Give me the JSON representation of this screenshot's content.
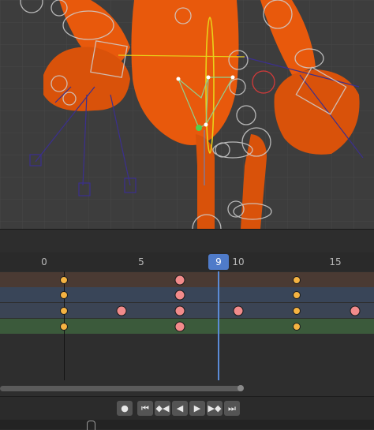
{
  "viewport": {
    "label": "3D viewport - orange character rig with bone controls",
    "colors": {
      "background": "#3d3d3d",
      "grid": "#4a4a4a",
      "character": "#e8590c",
      "character_dark": "#b8420a",
      "bones": "#3b2f8f",
      "control_circle": "#cfcfcf",
      "highlight": "#e8d21a",
      "active_green": "#4fd14f"
    }
  },
  "timeline": {
    "ruler_labels": [
      "0",
      "5",
      "10",
      "15"
    ],
    "current_frame": "9",
    "channel_colors": [
      "#4a3a33",
      "#394558",
      "#3b4454",
      "#3b5a3b"
    ],
    "keyframe_colors": {
      "selected_orange": "#f5b342",
      "pink": "#f28b8b"
    },
    "keyframes": [
      {
        "row": 0,
        "frame": 1,
        "style": "orange"
      },
      {
        "row": 0,
        "frame": 7,
        "style": "pink"
      },
      {
        "row": 0,
        "frame": 13,
        "style": "orange"
      },
      {
        "row": 1,
        "frame": 1,
        "style": "orange"
      },
      {
        "row": 1,
        "frame": 7,
        "style": "pink"
      },
      {
        "row": 1,
        "frame": 13,
        "style": "orange"
      },
      {
        "row": 2,
        "frame": 1,
        "style": "orange"
      },
      {
        "row": 2,
        "frame": 4,
        "style": "pink"
      },
      {
        "row": 2,
        "frame": 7,
        "style": "pink"
      },
      {
        "row": 2,
        "frame": 10,
        "style": "pink"
      },
      {
        "row": 2,
        "frame": 13,
        "style": "orange"
      },
      {
        "row": 2,
        "frame": 16,
        "style": "pink"
      },
      {
        "row": 3,
        "frame": 1,
        "style": "orange"
      },
      {
        "row": 3,
        "frame": 7,
        "style": "pink"
      },
      {
        "row": 3,
        "frame": 13,
        "style": "orange"
      }
    ]
  },
  "playback": {
    "record_icon": "record-icon",
    "buttons": [
      "jump-to-start-icon",
      "previous-keyframe-icon",
      "play-reverse-icon",
      "play-icon",
      "next-keyframe-icon",
      "jump-to-end-icon"
    ]
  },
  "statusbar": {
    "mouse_icon": "mouse-icon"
  }
}
